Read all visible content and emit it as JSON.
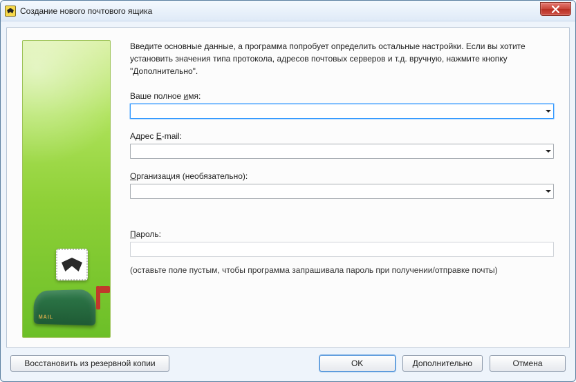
{
  "window": {
    "title": "Создание нового почтового ящика"
  },
  "instructions": "Введите основные данные, а программа попробует определить остальные настройки. Если вы хотите установить значения типа протокола, адресов почтовых серверов и т.д. вручную, нажмите кнопку \"Дополнительно\".",
  "fields": {
    "fullname": {
      "label_pre": "Ваше полное ",
      "label_ul": "и",
      "label_post": "мя:",
      "value": ""
    },
    "email": {
      "label_pre": "Адрес ",
      "label_ul": "E",
      "label_post": "-mail:",
      "value": ""
    },
    "org": {
      "label_pre": "",
      "label_ul": "О",
      "label_post": "рганизация (необязательно):",
      "value": ""
    },
    "password": {
      "label_pre": "",
      "label_ul": "П",
      "label_post": "ароль:",
      "value": ""
    }
  },
  "password_hint": "(оставьте поле пустым, чтобы программа запрашивала пароль при получении/отправке почты)",
  "buttons": {
    "restore": "Восстановить из резервной копии",
    "ok": "OK",
    "more": "Дополнительно",
    "cancel": "Отмена"
  }
}
